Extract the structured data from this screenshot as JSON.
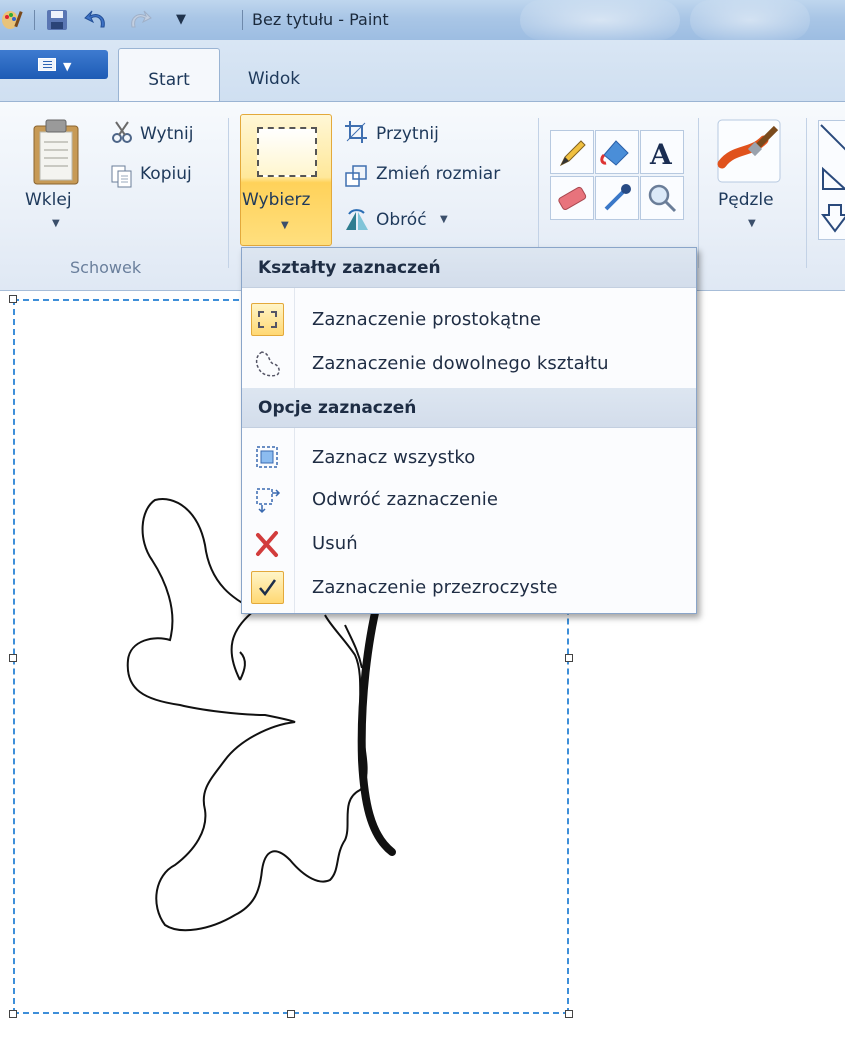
{
  "window": {
    "title": "Bez tytułu - Paint"
  },
  "tabs": [
    {
      "label": "Start",
      "active": true
    },
    {
      "label": "Widok",
      "active": false
    }
  ],
  "ribbon": {
    "clipboard": {
      "group_label": "Schowek",
      "paste_label": "Wklej",
      "cut_label": "Wytnij",
      "copy_label": "Kopiuj"
    },
    "image": {
      "select_label": "Wybierz",
      "crop_label": "Przytnij",
      "resize_label": "Zmień rozmiar",
      "rotate_label": "Obróć"
    },
    "brushes_label": "Pędzle"
  },
  "select_menu": {
    "section_shapes": "Kształty zaznaczeń",
    "rect_selection": "Zaznaczenie prostokątne",
    "free_selection": "Zaznaczenie dowolnego kształtu",
    "section_options": "Opcje zaznaczeń",
    "select_all": "Zaznacz wszystko",
    "invert_selection": "Odwróć zaznaczenie",
    "delete": "Usuń",
    "transparent_selection": "Zaznaczenie przezroczyste",
    "transparent_checked": true
  },
  "colors": {
    "accent_selected": "#ffd25a",
    "selection_dash": "#3e8fd9"
  }
}
